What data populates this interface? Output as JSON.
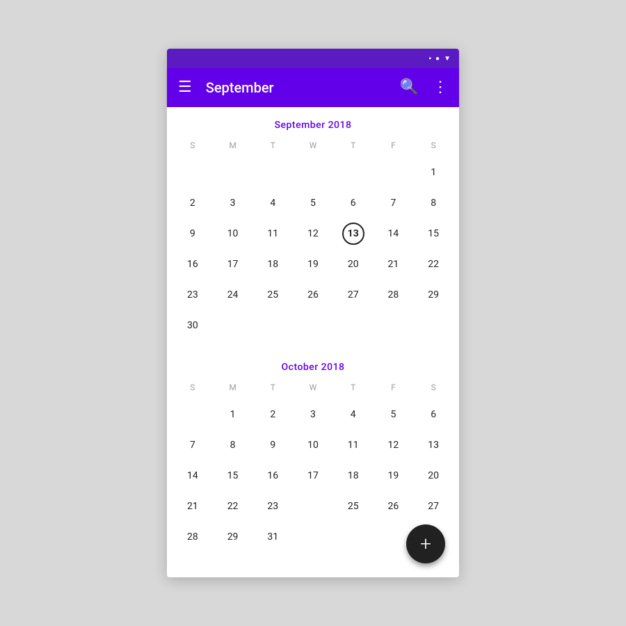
{
  "statusBar": {
    "icons": [
      "square",
      "circle",
      "triangle"
    ]
  },
  "appBar": {
    "menuIcon": "☰",
    "title": "September",
    "searchIcon": "🔍",
    "moreIcon": "⋮"
  },
  "calendar": {
    "months": [
      {
        "id": "september-2018",
        "title": "September  2018",
        "dayHeaders": [
          "S",
          "M",
          "T",
          "W",
          "T",
          "F",
          "S"
        ],
        "startDay": 6,
        "daysInMonth": 30,
        "todayDate": 13,
        "rows": [
          [
            "",
            "",
            "",
            "",
            "",
            "",
            "1"
          ],
          [
            "2",
            "3",
            "4",
            "5",
            "6",
            "7",
            "8"
          ],
          [
            "9",
            "10",
            "11",
            "12",
            "13",
            "14",
            "15"
          ],
          [
            "16",
            "17",
            "18",
            "19",
            "20",
            "21",
            "22"
          ],
          [
            "23",
            "24",
            "25",
            "26",
            "27",
            "28",
            "29"
          ],
          [
            "30",
            "",
            "",
            "",
            "",
            "",
            ""
          ]
        ]
      },
      {
        "id": "october-2018",
        "title": "October  2018",
        "dayHeaders": [
          "S",
          "M",
          "T",
          "W",
          "T",
          "F",
          "S"
        ],
        "startDay": 1,
        "daysInMonth": 31,
        "todayDate": null,
        "rows": [
          [
            "",
            "1",
            "2",
            "3",
            "4",
            "5",
            "6"
          ],
          [
            "7",
            "8",
            "9",
            "10",
            "11",
            "12",
            "13"
          ],
          [
            "14",
            "15",
            "16",
            "17",
            "18",
            "19",
            "20"
          ],
          [
            "21",
            "22",
            "23",
            "",
            "25",
            "26",
            "27"
          ],
          [
            "28",
            "29",
            "31",
            "",
            "",
            "",
            ""
          ]
        ]
      }
    ]
  },
  "fab": {
    "label": "+",
    "ariaLabel": "Add event"
  }
}
